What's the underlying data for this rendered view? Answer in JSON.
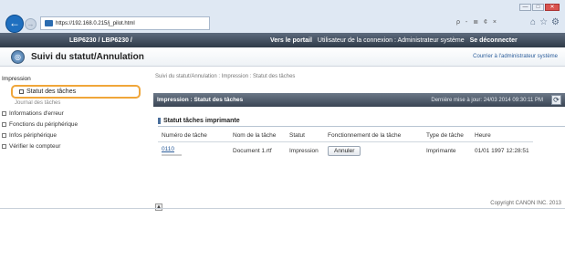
{
  "browser": {
    "window_buttons": [
      "—",
      "□",
      "✕"
    ],
    "back_glyph": "←",
    "forward_glyph": "→",
    "address": "https://192.168.0.215/j_pilot.html",
    "address_controls": "ρ - ≣ ¢ ×",
    "toolbar_icons": [
      "⌂",
      "☆",
      "⚙"
    ]
  },
  "header": {
    "device": "LBP6230 / LBP6230 /",
    "portal_link": "Vers le portail",
    "login_user": "Utilisateur de la connexion : Administrateur système",
    "logout_link": "Se déconnecter"
  },
  "page": {
    "title": "Suivi du statut/Annulation",
    "admin_link": "Courrier à l'administrateur système"
  },
  "sidebar": {
    "section": "Impression",
    "active_item": "Statut des tâches",
    "sub_item": "Journal des tâches",
    "items": [
      "Informations d'erreur",
      "Fonctions du périphérique",
      "Infos périphérique",
      "Vérifier le compteur"
    ]
  },
  "main": {
    "breadcrumb": "Suivi du statut/Annulation : Impression : Statut des tâches",
    "status_title": "Impression : Statut des tâches",
    "last_update": "Dernière mise à jour: 24/03 2014 09:30:11 PM",
    "refresh_glyph": "⟳",
    "subhead": "Statut tâches imprimante",
    "scroll_glyph": "▲",
    "table": {
      "headers": [
        "Numéro de tâche",
        "Nom de la tâche",
        "Statut",
        "Fonctionnement de la tâche",
        "Type de tâche",
        "Heure"
      ],
      "rows": [
        {
          "job_number": "0110",
          "job_name": "Document 1.rtf",
          "status": "Impression",
          "action_label": "Annuler",
          "job_type": "Imprimante",
          "time": "01/01 1997 12:28:51"
        }
      ]
    }
  },
  "footer": {
    "copyright": "Copyright CANON INC. 2013"
  }
}
